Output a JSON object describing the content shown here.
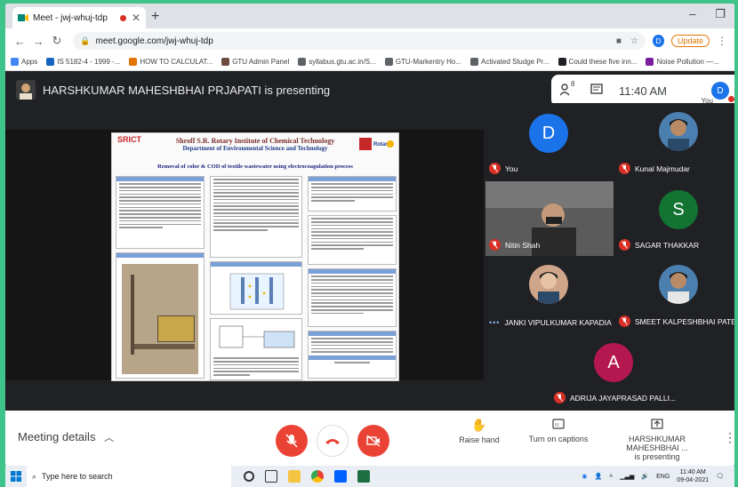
{
  "browser": {
    "tab_title": "Meet - jwj-whuj-tdp",
    "url": "meet.google.com/jwj-whuj-tdp",
    "profile_initial": "D",
    "update_label": "Update",
    "bookmarks": [
      {
        "label": "Apps",
        "icon": "apps-grid-icon"
      },
      {
        "label": "IS 5182-4 - 1999 -...",
        "icon": "document-icon"
      },
      {
        "label": "HOW TO CALCULAT...",
        "icon": "document-icon"
      },
      {
        "label": "GTU Admin Panel",
        "icon": "admin-icon"
      },
      {
        "label": "syllabus.gtu.ac.in/S...",
        "icon": "globe-icon"
      },
      {
        "label": "GTU-Markentry Ho...",
        "icon": "globe-icon"
      },
      {
        "label": "Activated Sludge Pr...",
        "icon": "globe-icon"
      },
      {
        "label": "Could these five inn...",
        "icon": "globe-icon"
      },
      {
        "label": "Noise Pollution —...",
        "icon": "globe-icon"
      }
    ]
  },
  "meet": {
    "presenter_banner": "HARSHKUMAR MAHESHBHAI PRJAPATI is presenting",
    "participant_count_badge": "8",
    "time": "11:40 AM",
    "you_label": "You",
    "self_initial": "D",
    "participants": [
      {
        "name": "You",
        "initial": "D",
        "color": "#1a73e8",
        "muted": true,
        "kind": "avatar"
      },
      {
        "name": "Kunal Majmudar",
        "initial": "",
        "color": "#1a1a1a",
        "muted": true,
        "kind": "photo"
      },
      {
        "name": "Nitin Shah",
        "initial": "",
        "color": "#3a3a3a",
        "muted": true,
        "kind": "video"
      },
      {
        "name": "SAGAR THAKKAR",
        "initial": "S",
        "color": "#137333",
        "muted": true,
        "kind": "avatar"
      },
      {
        "name": "JANKI VIPULKUMAR KAPADIA",
        "initial": "",
        "color": "#1a1a1a",
        "muted": false,
        "kind": "photo"
      },
      {
        "name": "SMEET KALPESHBHAI PATEL",
        "initial": "",
        "color": "#1a1a1a",
        "muted": true,
        "kind": "photo"
      },
      {
        "name": "ADRIJA JAYAPRASAD PALLI...",
        "initial": "A",
        "color": "#b5184f",
        "muted": true,
        "kind": "avatar"
      }
    ],
    "meeting_details_label": "Meeting details",
    "raise_hand_label": "Raise hand",
    "captions_label": "Turn on captions",
    "presenter_tool_name": "HARSHKUMAR MAHESHBHAI ...",
    "presenter_tool_status": "is presenting"
  },
  "poster": {
    "institute": "Shroff S.R. Rotary Institute of Chemical Technology",
    "department": "Department of Environmental Science and Technology",
    "title": "Removal of color & COD of textile wastewater using electrocoagulation process",
    "logo_left": "SRICT",
    "logo_right": "Rotary"
  },
  "taskbar": {
    "search_placeholder": "Type here to search",
    "language": "ENG",
    "clock_time": "11:40 AM",
    "clock_date": "09-04-2021"
  },
  "colors": {
    "meet_background": "#202124",
    "danger": "#ea4335",
    "accent_blue": "#1a73e8",
    "desktop_green": "#3ec38a"
  }
}
